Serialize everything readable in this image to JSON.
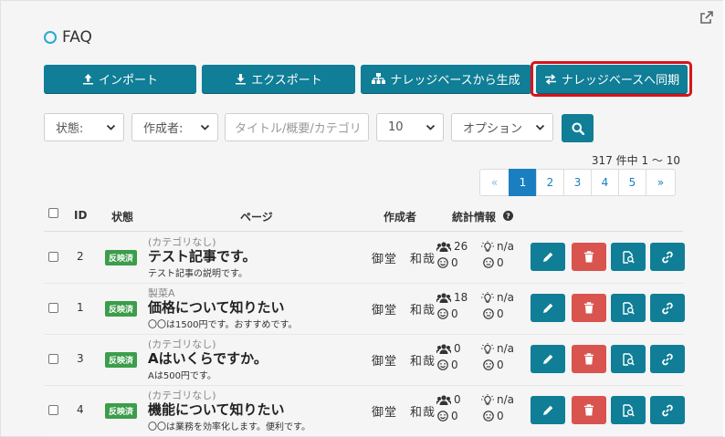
{
  "page": {
    "title": "FAQ"
  },
  "toolbar": {
    "import_label": "インポート",
    "export_label": "エクスポート",
    "generate_label": "ナレッジベースから生成",
    "sync_label": "ナレッジベースへ同期"
  },
  "filters": {
    "status_label": "状態:",
    "author_label": "作成者:",
    "search_placeholder": "タイトル/概要/カテゴリ",
    "per_page": "10",
    "options_label": "オプション"
  },
  "summary": "317 件中 1 ～ 10",
  "pagination": [
    "«",
    "1",
    "2",
    "3",
    "4",
    "5",
    "»"
  ],
  "table": {
    "headers": {
      "id": "ID",
      "status": "状態",
      "page": "ページ",
      "author": "作成者",
      "stats": "統計情報"
    },
    "rows": [
      {
        "id": "2",
        "status": "反映済",
        "category": "(カテゴリなし)",
        "title": "テスト記事です。",
        "description": "テスト記事の説明です。",
        "author": "御堂　和哉",
        "users": "26",
        "likes": "0",
        "ideas": "n/a",
        "dislikes": "0"
      },
      {
        "id": "1",
        "status": "反映済",
        "category": "製菜A",
        "title": "価格について知りたい",
        "description": "〇〇は1500円です。おすすめです。",
        "author": "御堂　和哉",
        "users": "18",
        "likes": "0",
        "ideas": "n/a",
        "dislikes": "0"
      },
      {
        "id": "3",
        "status": "反映済",
        "category": "(カテゴリなし)",
        "title": "Aはいくらですか。",
        "description": "Aは500円です。",
        "author": "御堂　和哉",
        "users": "0",
        "likes": "0",
        "ideas": "n/a",
        "dislikes": "0"
      },
      {
        "id": "4",
        "status": "反映済",
        "category": "(カテゴリなし)",
        "title": "機能について知りたい",
        "description": "〇〇は業務を効率化します。便利です。",
        "author": "御堂　和哉",
        "users": "0",
        "likes": "0",
        "ideas": "n/a",
        "dislikes": "0"
      }
    ]
  },
  "colors": {
    "primary": "#0f7e96",
    "danger": "#d9534f",
    "success": "#3c9d4a",
    "link": "#1a7fc1",
    "highlight": "#d8141a"
  }
}
